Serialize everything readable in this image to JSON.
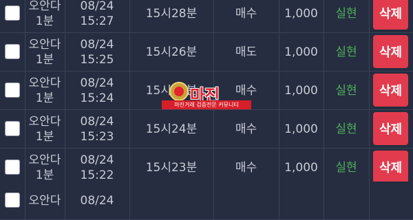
{
  "rows": [
    {
      "name": "오안다",
      "type": "1분",
      "date": "08/24",
      "time": "15:27",
      "round": "15시28분",
      "side": "매수",
      "amount": "1,000",
      "status": "실현",
      "delete_label": "삭제"
    },
    {
      "name": "오안다",
      "type": "1분",
      "date": "08/24",
      "time": "15:25",
      "round": "15시26분",
      "side": "매도",
      "amount": "1,000",
      "status": "실현",
      "delete_label": "삭제"
    },
    {
      "name": "오안다",
      "type": "1분",
      "date": "08/24",
      "time": "15:24",
      "round": "15시25분",
      "side": "매수",
      "amount": "1,000",
      "status": "실현",
      "delete_label": "삭제"
    },
    {
      "name": "오안다",
      "type": "1분",
      "date": "08/24",
      "time": "15:23",
      "round": "15시24분",
      "side": "매수",
      "amount": "1,000",
      "status": "실현",
      "delete_label": "삭제"
    },
    {
      "name": "오안다",
      "type": "1분",
      "date": "08/24",
      "time": "15:22",
      "round": "15시23분",
      "side": "매수",
      "amount": "1,000",
      "status": "실현",
      "delete_label": "삭제"
    },
    {
      "name": "오안다",
      "type": "",
      "date": "08/24",
      "time": "",
      "round": "",
      "side": "",
      "amount": "",
      "status": "",
      "delete_label": ""
    }
  ],
  "watermark": {
    "logo_text": "마진",
    "tagline": "마진거래 검증전문 커뮤니티"
  },
  "colors": {
    "background": "#1b2133",
    "row": "#262d40",
    "text": "#c8ccd6",
    "status": "#4fae5b",
    "delete": "#e23b4d"
  }
}
